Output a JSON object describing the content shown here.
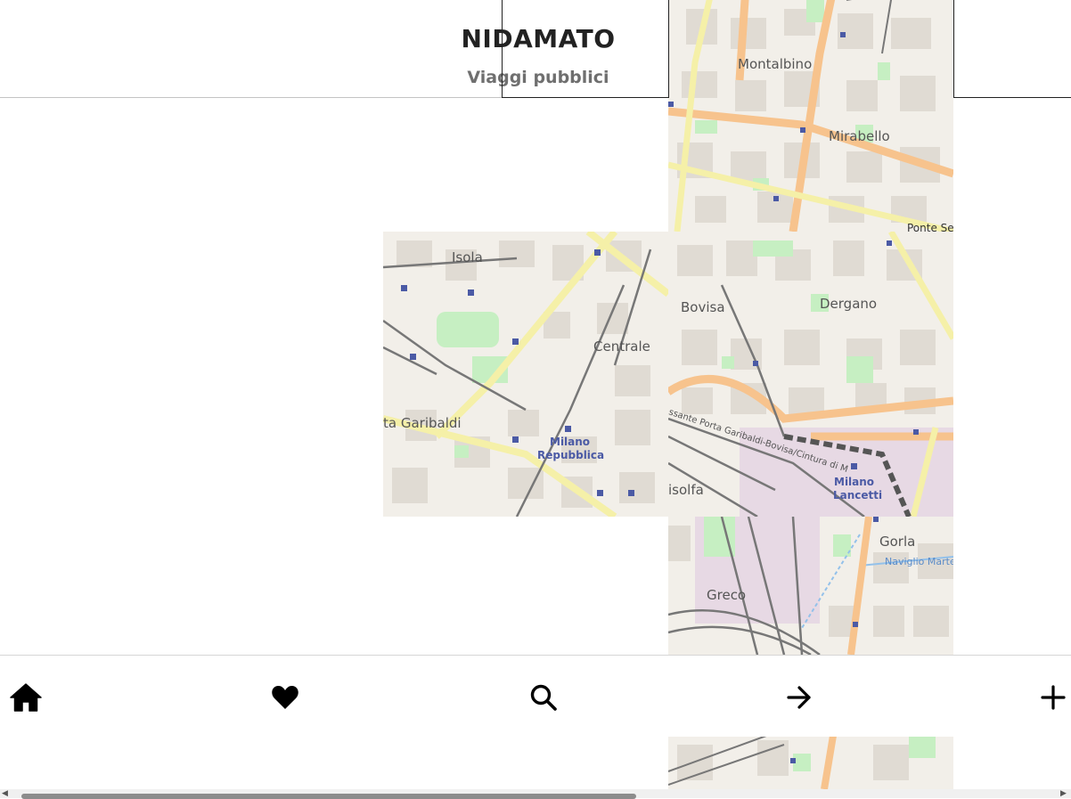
{
  "header": {
    "title": "NIDAMATO",
    "subtitle": "Viaggi pubblici"
  },
  "map": {
    "labels": {
      "montalbino": "Montalbino",
      "mirabello": "Mirabello",
      "ponte_se": "Ponte Se",
      "isola": "Isola",
      "centrale": "Centrale",
      "garibaldi": "ta Garibaldi",
      "milano_repubblica_1": "Milano",
      "milano_repubblica_2": "Repubblica",
      "bovisa": "Bovisa",
      "dergano": "Dergano",
      "isolfa": "isolfa",
      "milano_lancetti_1": "Milano",
      "milano_lancetti_2": "Lancetti",
      "ferrovia_label": "ssante Porta Garibaldi-Bovisa/Cintura di M",
      "greco": "Greco",
      "gorla": "Gorla",
      "naviglio": "Naviglio Marte"
    },
    "colors": {
      "background": "#f2efe9",
      "block": "#e0dbd3",
      "major_road": "#f7c38d",
      "secondary_road": "#f5f0a8",
      "park": "#c6efc2",
      "rail": "#777777",
      "station": "#4b5aa5",
      "water": "#93c1ea"
    }
  },
  "nav": {
    "items": [
      {
        "icon": "home-icon",
        "label": "Home"
      },
      {
        "icon": "heart-icon",
        "label": "Preferiti"
      },
      {
        "icon": "search-icon",
        "label": "Cerca"
      },
      {
        "icon": "arrow-right-icon",
        "label": "Avanti"
      },
      {
        "icon": "plus-icon",
        "label": "Nuovo"
      }
    ]
  }
}
